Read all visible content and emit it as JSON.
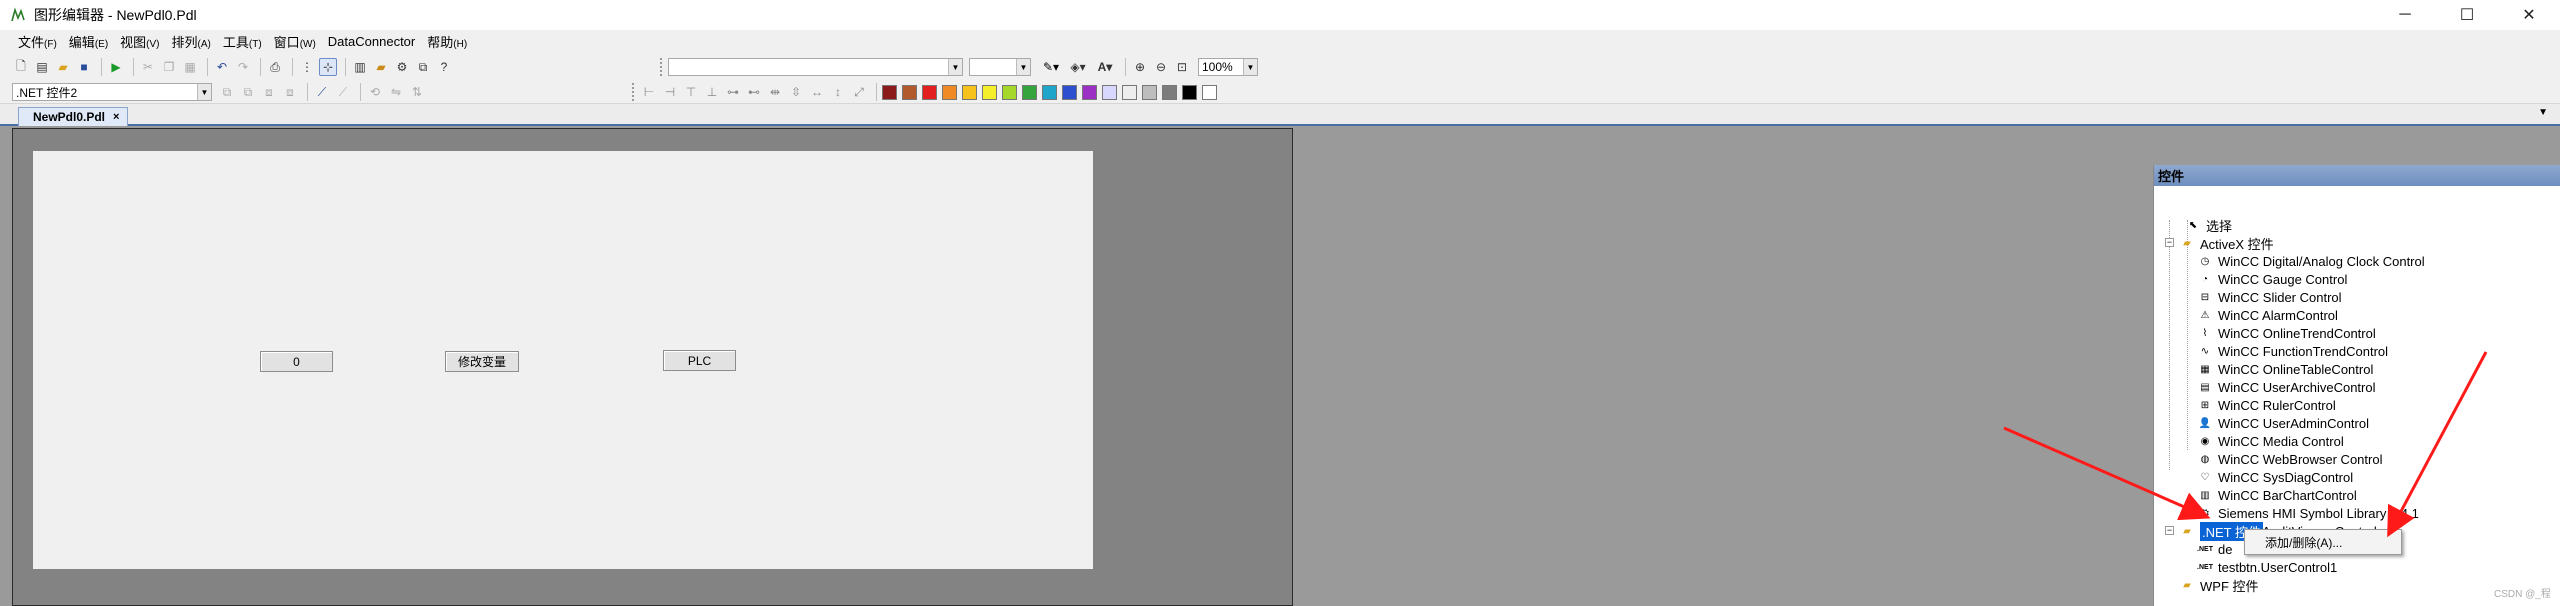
{
  "window": {
    "title": "图形编辑器 - NewPdl0.Pdl",
    "minimize": "─",
    "maximize": "☐",
    "close": "✕",
    "app_icon": "graphics-designer-icon"
  },
  "menu": [
    {
      "label": "文件",
      "key": "(F)"
    },
    {
      "label": "编辑",
      "key": "(E)"
    },
    {
      "label": "视图",
      "key": "(V)"
    },
    {
      "label": "排列",
      "key": "(A)"
    },
    {
      "label": "工具",
      "key": "(T)"
    },
    {
      "label": "窗口",
      "key": "(W)"
    },
    {
      "label": "DataConnector",
      "key": ""
    },
    {
      "label": "帮助",
      "key": "(H)"
    }
  ],
  "toolbar": {
    "zoom_value": "100%",
    "control_selector_value": ".NET 控件2",
    "font_combo_value": "",
    "size_combo_value": ""
  },
  "palette": [
    "#8b1a1a",
    "#b25a2c",
    "#e31e1e",
    "#f08a24",
    "#f6c21b",
    "#f5ee2a",
    "#a5d82b",
    "#33a53c",
    "#1fa5c9",
    "#2c4fd0",
    "#9c2fc4",
    "#d8d8ff",
    "#ededed",
    "#bdbdbd",
    "#7c7c7c",
    "#000000",
    "#ffffff"
  ],
  "tab": {
    "label": "NewPdl0.Pdl",
    "close": "×"
  },
  "picture": {
    "io_field_value": "0",
    "modify_button_label": "修改变量",
    "plc_button_label": "PLC"
  },
  "object_palette": {
    "title": "控件",
    "select_label": "选择",
    "activex_group": "ActiveX 控件",
    "activex_items": [
      "WinCC Digital/Analog Clock Control",
      "WinCC Gauge Control",
      "WinCC Slider Control",
      "WinCC AlarmControl",
      "WinCC OnlineTrendControl",
      "WinCC FunctionTrendControl",
      "WinCC OnlineTableControl",
      "WinCC UserArchiveControl",
      "WinCC RulerControl",
      "WinCC UserAdminControl",
      "WinCC Media Control",
      "WinCC WebBrowser Control",
      "WinCC SysDiagControl",
      "WinCC BarChartControl",
      "Siemens HMI Symbol Library 1.4.1",
      "WinCC AuditViewer Control"
    ],
    "net_group": ".NET 控件",
    "net_items": [
      "de",
      "testbtn.UserControl1"
    ],
    "wpf_group": "WPF 控件"
  },
  "context_menu": {
    "add_remove": "添加/删除(A)..."
  },
  "watermark": "CSDN @_程",
  "accent_colors": {
    "selection": "#0a64d6",
    "annotation_arrow": "#ff1a1a",
    "panel_header": "#7d9ac6"
  }
}
